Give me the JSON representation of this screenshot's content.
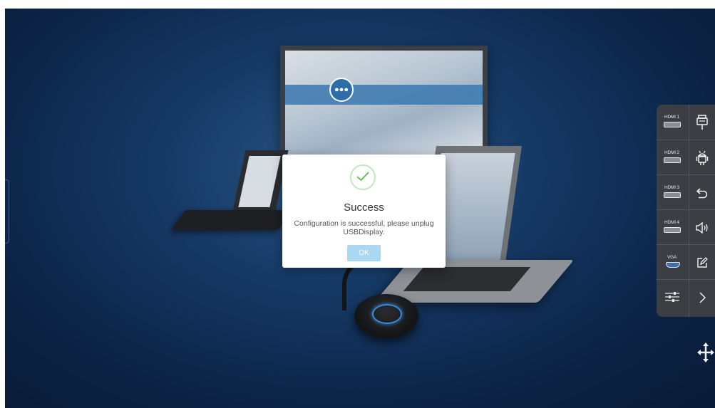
{
  "dialog": {
    "icon": "checkmark-icon",
    "title": "Success",
    "message": "Configuration is successful, please unplug USBDisplay.",
    "ok_label": "OK"
  },
  "side_panel": {
    "sources": [
      {
        "label": "HDMI 1",
        "icon": "hdmi-port-icon"
      },
      {
        "label": "HDMI 2",
        "icon": "hdmi-port-icon"
      },
      {
        "label": "HDMI 3",
        "icon": "hdmi-port-icon"
      },
      {
        "label": "HDMI 4",
        "icon": "hdmi-port-icon"
      },
      {
        "label": "VGA",
        "icon": "vga-port-icon"
      },
      {
        "label": "",
        "icon": "settings-sliders-icon"
      }
    ],
    "actions": [
      "projector-icon",
      "android-icon",
      "back-icon",
      "volume-icon",
      "annotate-icon",
      "expand-icon"
    ]
  },
  "colors": {
    "background": "#0c2447",
    "panel": "#3b3e43",
    "ok_button": "#a8d8f2",
    "check": "#5cc95c"
  }
}
